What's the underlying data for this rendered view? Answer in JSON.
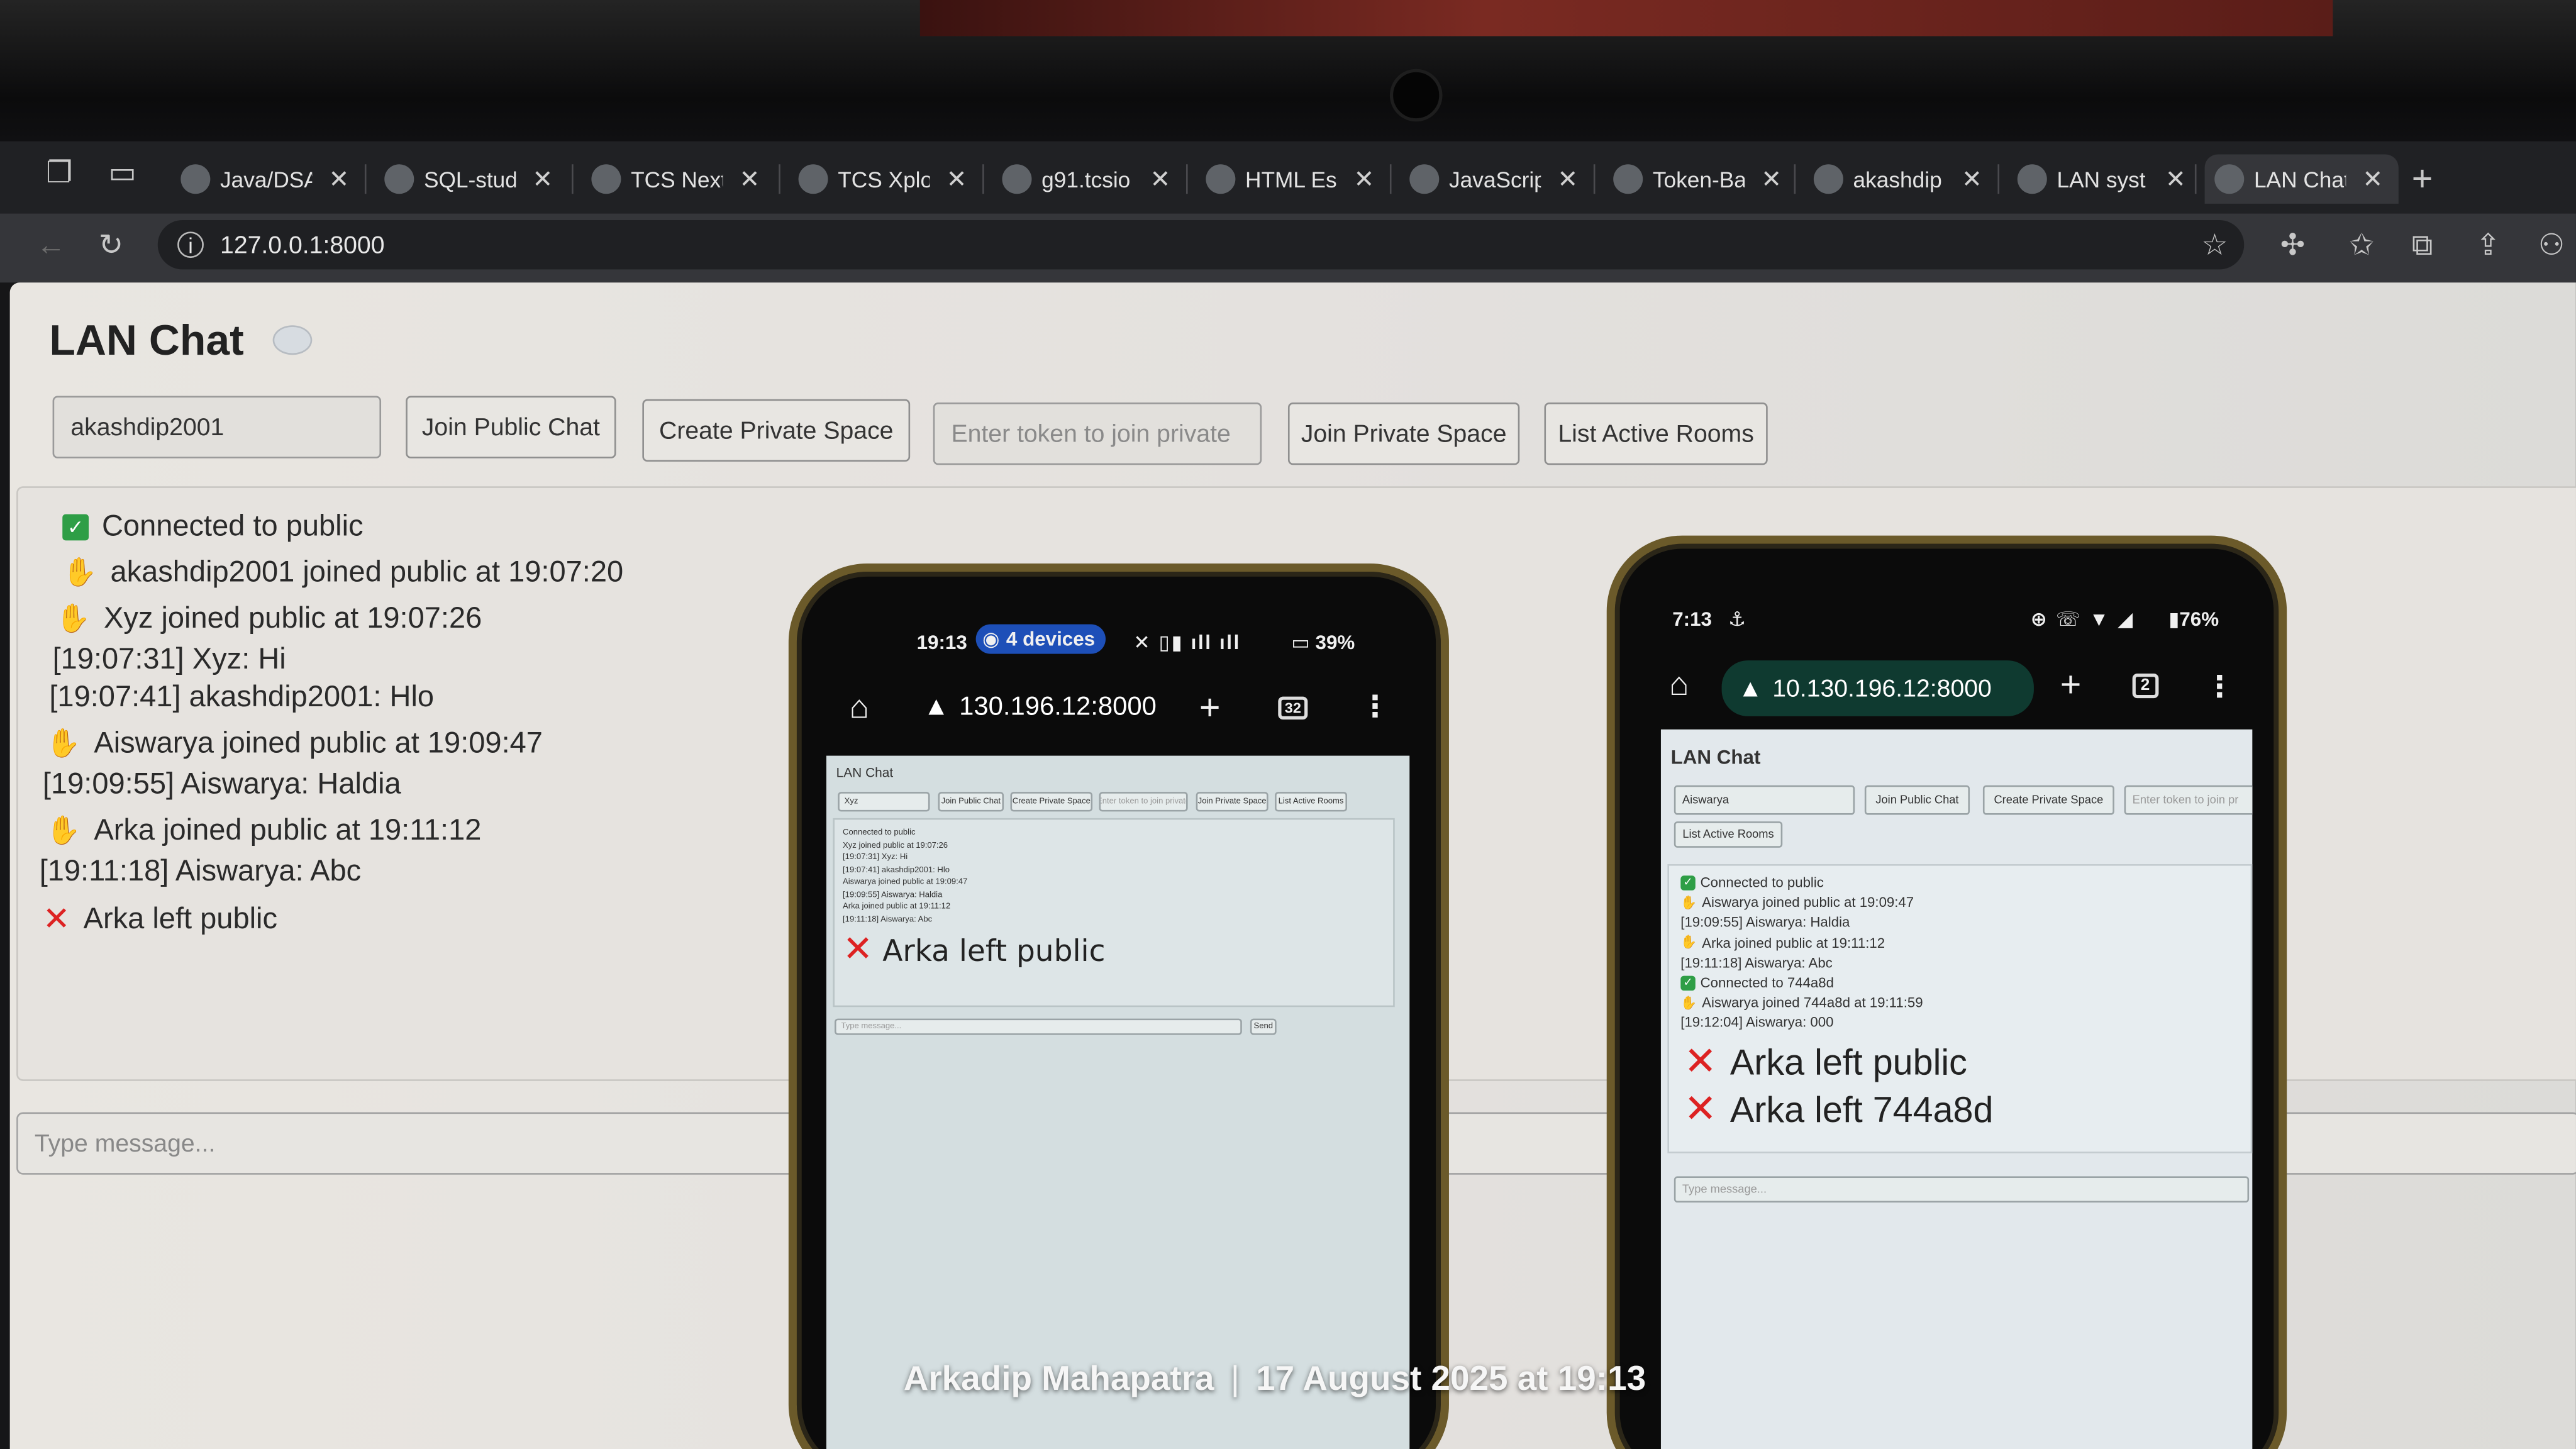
{
  "browser": {
    "tabs": [
      {
        "label": "Java/DSA",
        "icon": "github-icon"
      },
      {
        "label": "SQL-stud",
        "icon": "github-icon"
      },
      {
        "label": "TCS Next",
        "icon": "gmail-icon"
      },
      {
        "label": "TCS Xplo",
        "icon": "tcs-icon"
      },
      {
        "label": "g91.tcsio",
        "icon": "document-icon"
      },
      {
        "label": "HTML Ess",
        "icon": "video-icon"
      },
      {
        "label": "JavaScrip",
        "icon": "github-icon"
      },
      {
        "label": "Token-Ba",
        "icon": "github-icon"
      },
      {
        "label": "akashdip",
        "icon": "github-icon"
      },
      {
        "label": "LAN syst",
        "icon": "chatgpt-icon"
      },
      {
        "label": "LAN Chat",
        "icon": "globe-icon",
        "active": true
      }
    ],
    "url": "127.0.0.1:8000"
  },
  "app": {
    "title": "LAN Chat",
    "username": "akashdip2001",
    "join_public_label": "Join Public Chat",
    "create_private_label": "Create Private Space",
    "token_placeholder": "Enter token to join private",
    "join_private_label": "Join Private Space",
    "list_rooms_label": "List Active Rooms",
    "message_placeholder": "Type message..."
  },
  "laptop_log": [
    {
      "type": "ok",
      "text": "Connected to public"
    },
    {
      "type": "join",
      "text": "akashdip2001 joined public at 19:07:20"
    },
    {
      "type": "join",
      "text": "Xyz joined public at 19:07:26"
    },
    {
      "type": "msg",
      "text": "[19:07:31] Xyz: Hi"
    },
    {
      "type": "msg",
      "text": "[19:07:41] akashdip2001: Hlo"
    },
    {
      "type": "join",
      "text": "Aiswarya joined public at 19:09:47"
    },
    {
      "type": "msg",
      "text": "[19:09:55] Aiswarya: Haldia"
    },
    {
      "type": "join",
      "text": "Arka joined public at 19:11:12"
    },
    {
      "type": "msg",
      "text": "[19:11:18] Aiswarya: Abc"
    },
    {
      "type": "leave",
      "text": "Arka left public"
    }
  ],
  "phone_left": {
    "time": "19:13",
    "devices": "4 devices",
    "battery": "39%",
    "url": "130.196.12:8000",
    "tab_count": "32",
    "username": "Xyz",
    "log": [
      "Connected to public",
      "Xyz joined public at 19:07:26",
      "[19:07:31] Xyz: Hi",
      "[19:07:41] akashdip2001: Hlo",
      "Aiswarya joined public at 19:09:47",
      "[19:09:55] Aiswarya: Haldia",
      "Arka joined public at 19:11:12",
      "[19:11:18] Aiswarya: Abc"
    ],
    "big_line": "Arka left public",
    "send_label": "Send",
    "message_placeholder": "Type message..."
  },
  "phone_right": {
    "time": "7:13",
    "battery": "76%",
    "url": "10.130.196.12:8000",
    "tab_count": "2",
    "username": "Aiswarya",
    "token_placeholder": "Enter token to join pr",
    "log": [
      {
        "type": "ok",
        "text": "Connected to public"
      },
      {
        "type": "join",
        "text": "Aiswarya joined public at 19:09:47"
      },
      {
        "type": "msg",
        "text": "[19:09:55] Aiswarya: Haldia"
      },
      {
        "type": "join",
        "text": "Arka joined public at 19:11:12"
      },
      {
        "type": "msg",
        "text": "[19:11:18] Aiswarya: Abc"
      },
      {
        "type": "ok",
        "text": "Connected to 744a8d"
      },
      {
        "type": "join",
        "text": "Aiswarya joined 744a8d at 19:11:59"
      },
      {
        "type": "msg",
        "text": "[19:12:04] Aiswarya: 000"
      }
    ],
    "big_lines": [
      "Arka left public",
      "Arka left 744a8d"
    ],
    "message_placeholder": "Type message..."
  },
  "watermark": {
    "author": "Arkadip Mahapatra",
    "date": "17 August 2025 at 19:13"
  }
}
